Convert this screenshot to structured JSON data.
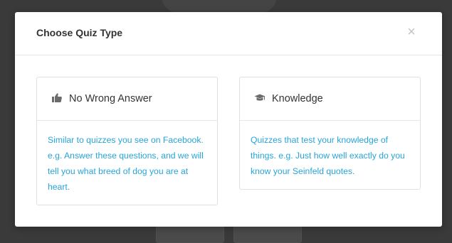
{
  "modal": {
    "title": "Choose Quiz Type",
    "close_label": "×"
  },
  "options": [
    {
      "title": "No Wrong Answer",
      "icon": "thumbs-up-icon",
      "description": "Similar to quizzes you see on Facebook. e.g. Answer these questions, and we will tell you what breed of dog you are at heart."
    },
    {
      "title": "Knowledge",
      "icon": "graduation-cap-icon",
      "description": "Quizzes that test your knowledge of things. e.g. Just how well exactly do you know your Seinfeld quotes."
    }
  ],
  "colors": {
    "accent": "#27a4d9",
    "overlay": "#3a3a3a",
    "title_text": "#333333"
  }
}
